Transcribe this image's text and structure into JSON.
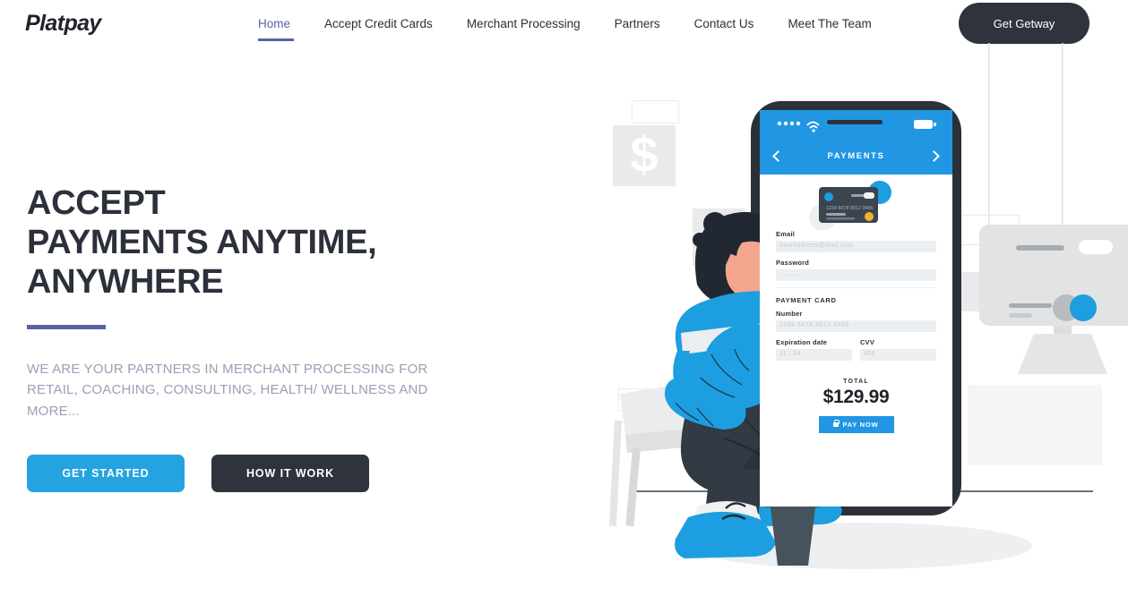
{
  "brand": {
    "name": "Platpay"
  },
  "nav": {
    "links": [
      {
        "label": "Home",
        "active": true
      },
      {
        "label": "Accept Credit Cards",
        "active": false
      },
      {
        "label": "Merchant Processing",
        "active": false
      },
      {
        "label": "Partners",
        "active": false
      },
      {
        "label": "Contact Us",
        "active": false
      },
      {
        "label": "Meet The Team",
        "active": false
      }
    ],
    "cta_label": "Get Getway"
  },
  "hero": {
    "headline_line1": "ACCEPT",
    "headline_line2": "PAYMENTS ANYTIME,",
    "headline_line3": "ANYWHERE",
    "subcopy": "WE ARE YOUR PARTNERS IN MERCHANT PROCESSING FOR RETAIL, COACHING, CONSULTING, HEALTH/ WELLNESS AND MORE...",
    "primary_button": "GET STARTED",
    "secondary_button": "HOW IT WORK"
  },
  "phone": {
    "title": "PAYMENTS",
    "email_label": "Email",
    "email_placeholder": "emailadress@mail.com",
    "password_label": "Password",
    "password_placeholder": "............",
    "section_title": "PAYMENT CARD",
    "number_label": "Number",
    "number_placeholder": "1234 5678 9012 3456",
    "expiry_label": "Expiration date",
    "expiry_placeholder": "11 / 04",
    "cvv_label": "CVV",
    "cvv_placeholder": "456",
    "total_label": "TOTAL",
    "total_amount": "$129.99",
    "pay_label": "PAY NOW"
  },
  "decor": {
    "money_symbol": "$",
    "bg_card_number": "5678  9012  3456"
  },
  "colors": {
    "accent_blue": "#25a3e0",
    "phone_blue": "#2196e3",
    "dark": "#2f333c",
    "purple": "#5a62a8",
    "muted_text": "#9aa0b5"
  }
}
